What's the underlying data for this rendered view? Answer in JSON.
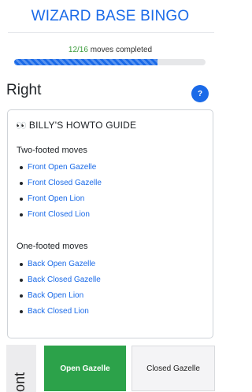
{
  "header": {
    "title": "WIZARD BASE BINGO"
  },
  "progress": {
    "completed": "12/16",
    "label": " moves completed",
    "fraction": 0.75
  },
  "section": {
    "title": "Right",
    "help_label": "?"
  },
  "guide": {
    "eyes_icon": "👀",
    "title": "BILLY'S HOWTO GUIDE",
    "groups": [
      {
        "title": "Two-footed moves",
        "items": [
          "Front Open Gazelle",
          "Front Closed Gazelle",
          "Front Open Lion",
          "Front Closed Lion"
        ]
      },
      {
        "title": "One-footed moves",
        "items": [
          "Back Open Gazelle",
          "Back Closed Gazelle",
          "Back Open Lion",
          "Back Closed Lion"
        ]
      }
    ]
  },
  "grid": {
    "side_label": "ont",
    "tiles": [
      {
        "label": "Open Gazelle",
        "state": "completed"
      },
      {
        "label": "Closed Gazelle",
        "state": "pending"
      }
    ]
  },
  "colors": {
    "accent": "#1a6ae8",
    "success": "#2ca24a",
    "count_text": "#3a9a3a"
  }
}
